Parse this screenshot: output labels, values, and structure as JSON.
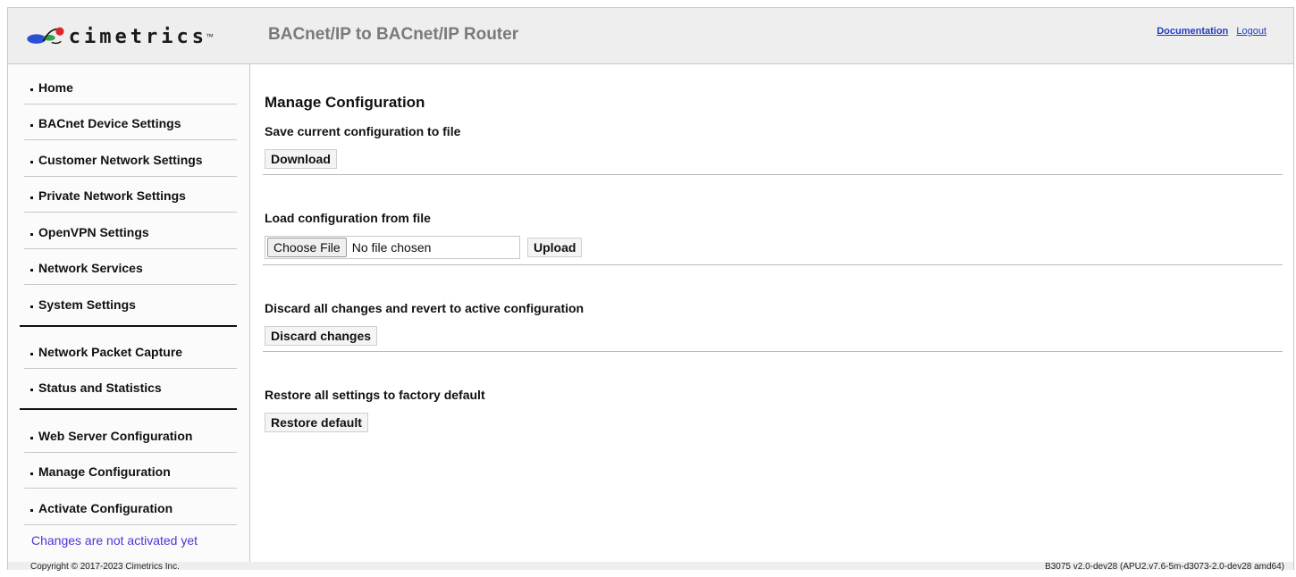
{
  "header": {
    "brand": "cimetrics",
    "brand_tm": "™",
    "title": "BACnet/IP to BACnet/IP Router",
    "links": {
      "documentation": "Documentation",
      "logout": "Logout"
    }
  },
  "sidebar": {
    "items": [
      {
        "label": "Home"
      },
      {
        "label": "BACnet Device Settings"
      },
      {
        "label": "Customer Network Settings"
      },
      {
        "label": "Private Network Settings"
      },
      {
        "label": "OpenVPN Settings"
      },
      {
        "label": "Network Services"
      },
      {
        "label": "System Settings"
      },
      {
        "label": "Network Packet Capture"
      },
      {
        "label": "Status and Statistics"
      },
      {
        "label": "Web Server Configuration"
      },
      {
        "label": "Manage Configuration"
      },
      {
        "label": "Activate Configuration"
      }
    ],
    "status_note": "Changes are not activated yet"
  },
  "main": {
    "title": "Manage Configuration",
    "save": {
      "label": "Save current configuration to file",
      "button": "Download"
    },
    "load": {
      "label": "Load configuration from file",
      "choose_button": "Choose File",
      "file_status": "No file chosen",
      "button": "Upload"
    },
    "discard": {
      "label": "Discard all changes and revert to active configuration",
      "button": "Discard changes"
    },
    "restore": {
      "label": "Restore all settings to factory default",
      "button": "Restore default"
    }
  },
  "footer": {
    "copyright": "Copyright © 2017-2023 Cimetrics Inc.",
    "version": "B3075 v2.0-dev28 (APU2.v7.6-5m-d3073-2.0-dev28 amd64)"
  },
  "colors": {
    "header_bg": "#eeeeee",
    "link": "#1f3fbf",
    "status_note": "#4a36d8",
    "title_gray": "#7a7a7a"
  }
}
